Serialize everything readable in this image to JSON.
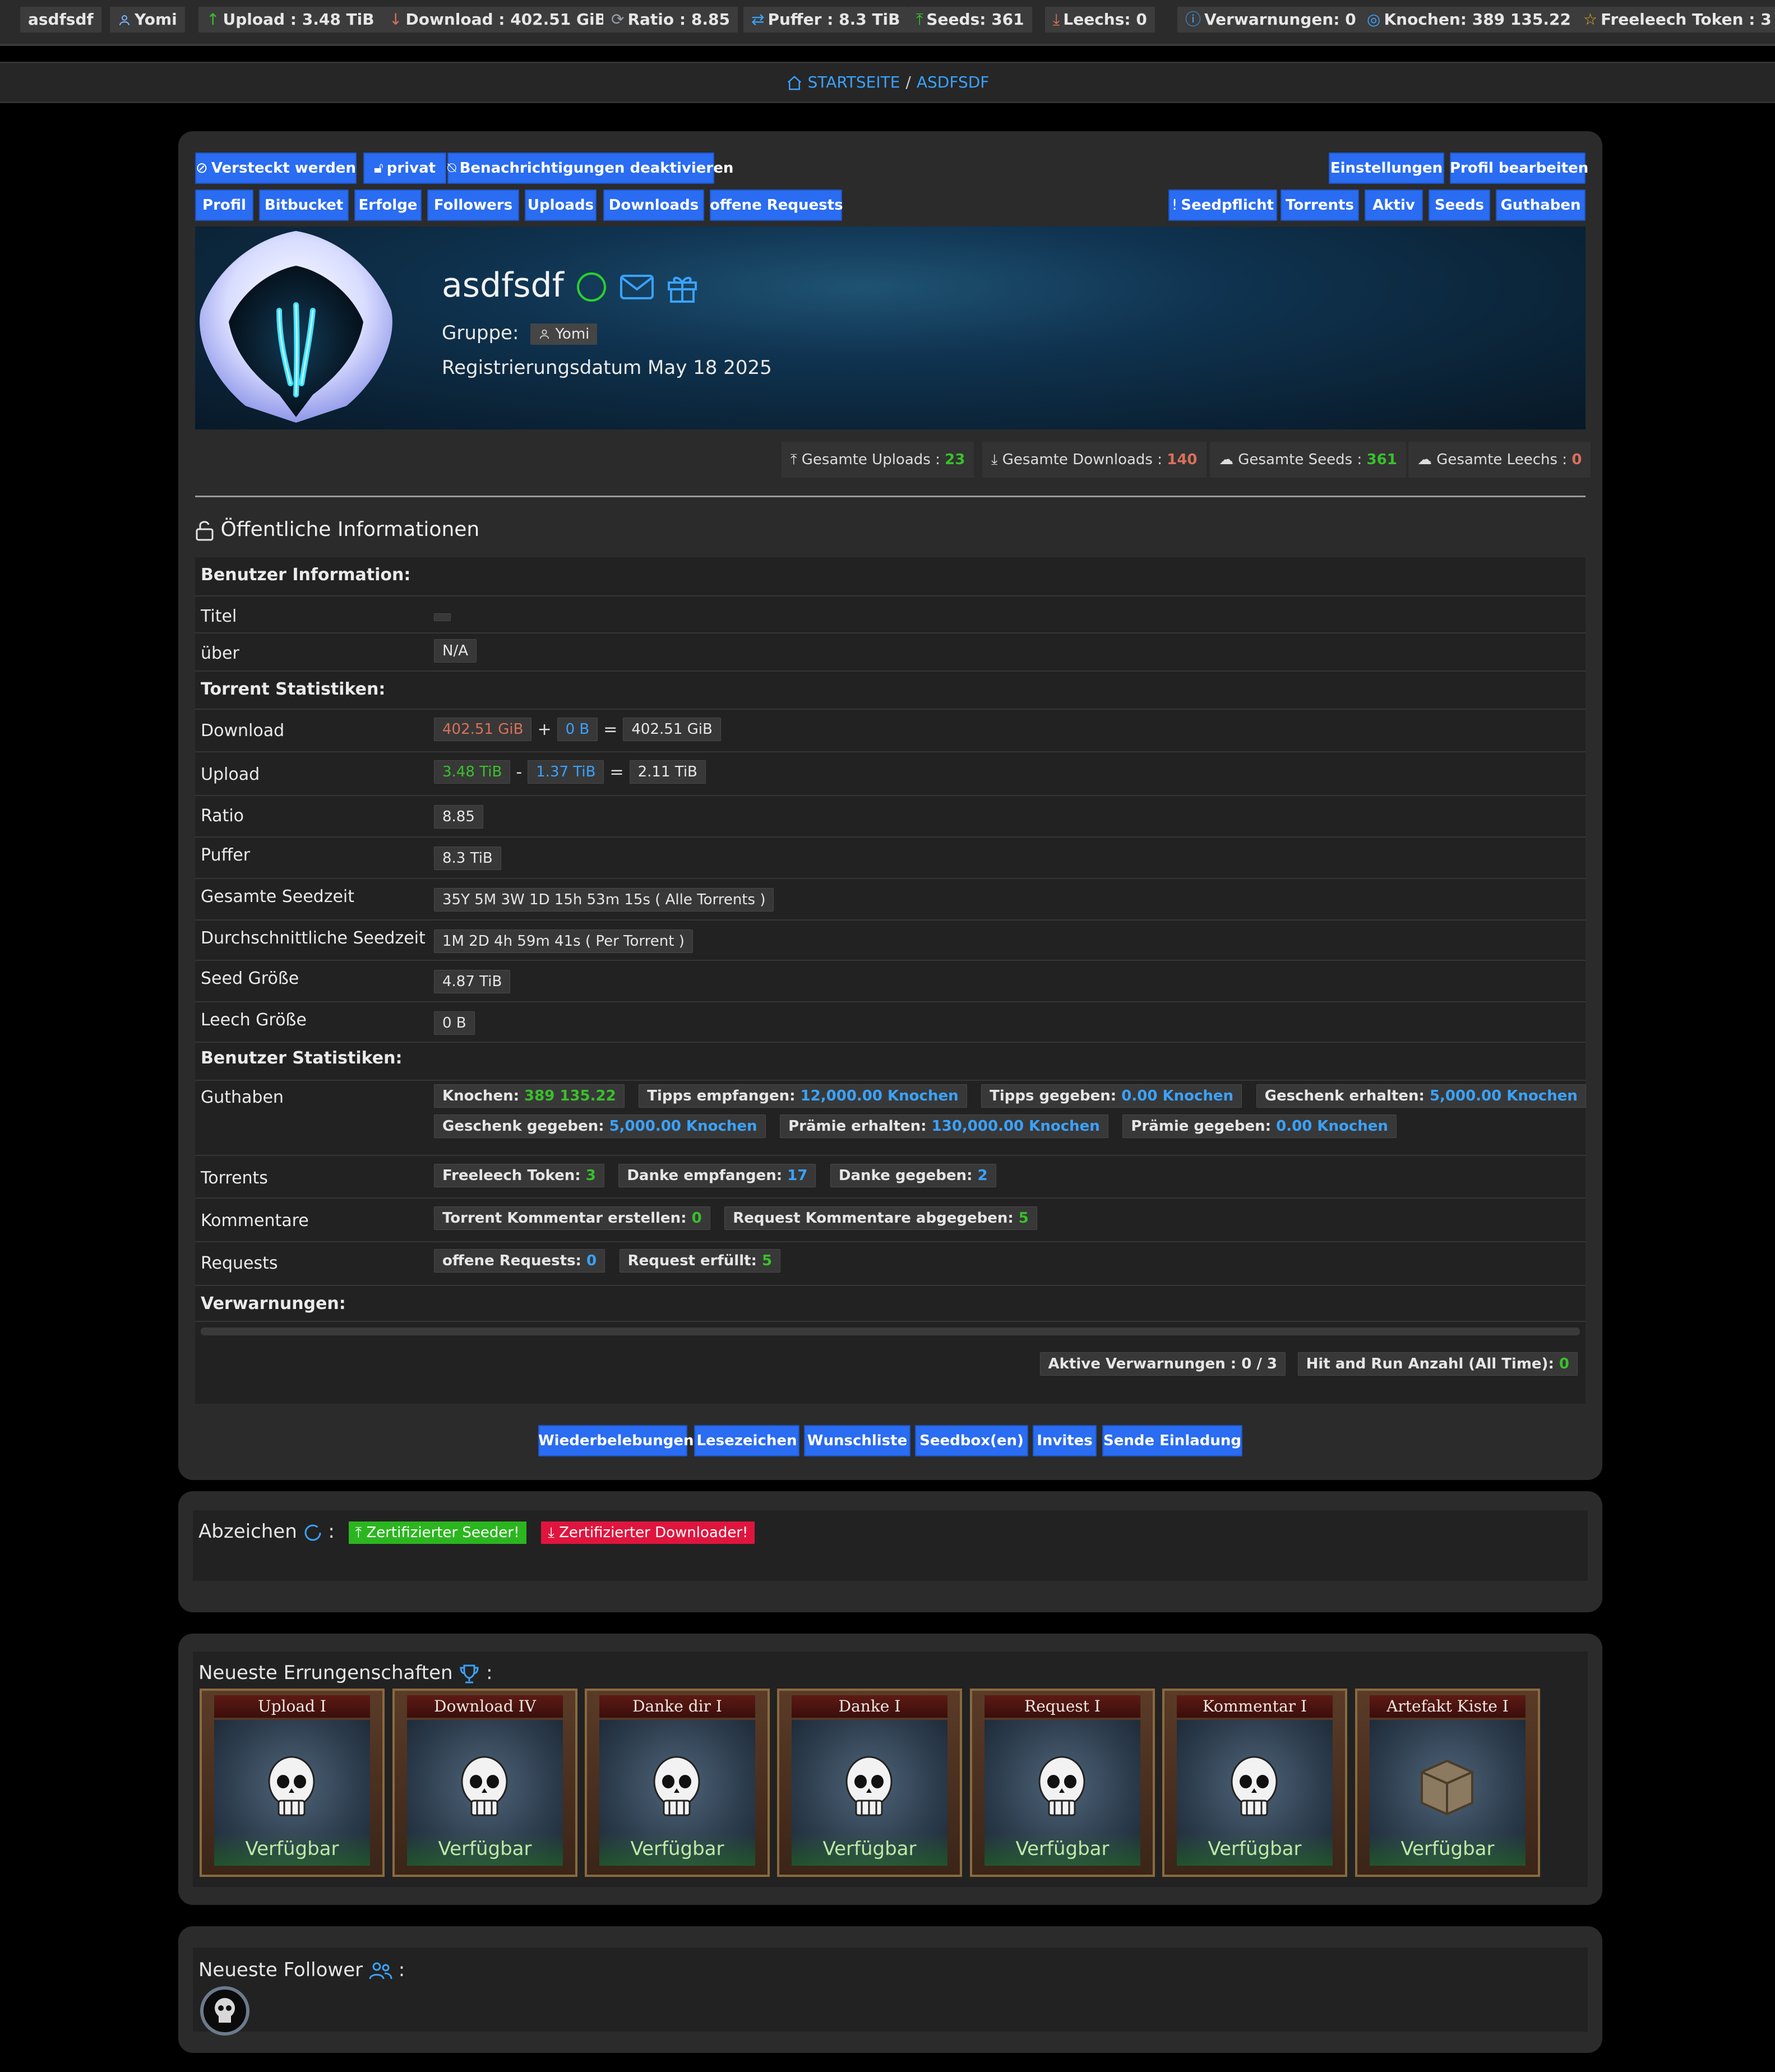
{
  "topbar": {
    "username": "asdfsdf",
    "group": "Yomi",
    "upload": "Upload : 3.48 TiB",
    "download": "Download : 402.51 GiB",
    "ratio": "Ratio : 8.85",
    "puffer": "Puffer : 8.3 TiB",
    "seeds": "Seeds: 361",
    "leechs": "Leechs: 0",
    "warnings": "Verwarnungen: 0",
    "knochen": "Knochen: 389 135.22",
    "freeleech": "Freeleech Token : 3"
  },
  "breadcrumb": {
    "home": "STARTSEITE",
    "separator": "/",
    "current": "ASDFSDF"
  },
  "profile": {
    "action_buttons": [
      "Versteckt werden",
      "privat",
      "Benachrichtigungen deaktivieren"
    ],
    "settings_buttons": [
      "Einstellungen",
      "Profil bearbeiten"
    ],
    "nav_tabs": [
      "Profil",
      "Bitbucket",
      "Erfolge",
      "Followers",
      "Uploads",
      "Downloads",
      "offene Requests"
    ],
    "nav_tabs_right": [
      "Seedpflicht",
      "Torrents",
      "Aktiv",
      "Seeds",
      "Guthaben"
    ],
    "name": "asdfsdf",
    "group_label": "Gruppe:",
    "group_value": "Yomi",
    "registration": "Registrierungsdatum May 18 2025",
    "totals": {
      "uploads_label": "Gesamte Uploads :",
      "uploads_value": "23",
      "downloads_label": "Gesamte Downloads :",
      "downloads_value": "140",
      "seeds_label": "Gesamte Seeds :",
      "seeds_value": "361",
      "leechs_label": "Gesamte Leechs :",
      "leechs_value": "0"
    }
  },
  "info": {
    "title": "Öffentliche Informationen",
    "user_info_header": "Benutzer Information:",
    "titel_label": "Titel",
    "ueber_label": "über",
    "ueber_value": "N/A",
    "torrent_stats_header": "Torrent Statistiken:",
    "download_label": "Download",
    "download_a": "402.51 GiB",
    "download_op1": "+",
    "download_b": "0 B",
    "download_op2": "=",
    "download_c": "402.51 GiB",
    "upload_label": "Upload",
    "upload_a": "3.48 TiB",
    "upload_op1": "-",
    "upload_b": "1.37 TiB",
    "upload_op2": "=",
    "upload_c": "2.11 TiB",
    "ratio_label": "Ratio",
    "ratio_value": "8.85",
    "puffer_label": "Puffer",
    "puffer_value": "8.3 TiB",
    "seedtime_label": "Gesamte Seedzeit",
    "seedtime_value": "35Y 5M 3W 1D 15h 53m 15s ( Alle Torrents )",
    "avg_seedtime_label": "Durchschnittliche Seedzeit",
    "avg_seedtime_value": "1M 2D 4h 59m 41s ( Per Torrent )",
    "seedsize_label": "Seed Größe",
    "seedsize_value": "4.87 TiB",
    "leechsize_label": "Leech Größe",
    "leechsize_value": "0 B",
    "user_stats_header": "Benutzer Statistiken:",
    "guthaben_label": "Guthaben",
    "knochen_label": "Knochen:",
    "knochen_value": "389 135.22",
    "tips_recv_label": "Tipps empfangen:",
    "tips_recv_value": "12,000.00 Knochen",
    "tips_given_label": "Tipps gegeben:",
    "tips_given_value": "0.00 Knochen",
    "gift_recv_label": "Geschenk erhalten:",
    "gift_recv_value": "5,000.00 Knochen",
    "gift_given_label": "Geschenk gegeben:",
    "gift_given_value": "5,000.00 Knochen",
    "bounty_recv_label": "Prämie erhalten:",
    "bounty_recv_value": "130,000.00 Knochen",
    "bounty_given_label": "Prämie gegeben:",
    "bounty_given_value": "0.00 Knochen",
    "torrents_label": "Torrents",
    "freeleech_label": "Freeleech Token:",
    "freeleech_value": "3",
    "thanks_recv_label": "Danke empfangen:",
    "thanks_recv_value": "17",
    "thanks_given_label": "Danke gegeben:",
    "thanks_given_value": "2",
    "comments_label": "Kommentare",
    "torrent_comment_label": "Torrent Kommentar erstellen:",
    "torrent_comment_value": "0",
    "request_comment_label": "Request Kommentare abgegeben:",
    "request_comment_value": "5",
    "requests_label": "Requests",
    "open_requests_label": "offene Requests:",
    "open_requests_value": "0",
    "filled_requests_label": "Request erfüllt:",
    "filled_requests_value": "5",
    "warnings_header": "Verwarnungen:",
    "active_warnings": "Aktive Verwarnungen : 0 / 3",
    "hnr_label": "Hit and Run Anzahl (All Time):",
    "hnr_value": "0"
  },
  "bottom_buttons": [
    "Wiederbelebungen",
    "Lesezeichen",
    "Wunschliste",
    "Seedbox(en)",
    "Invites",
    "Sende Einladung"
  ],
  "badges": {
    "title": "Abzeichen",
    "colon": ":",
    "seeder": "Zertifizierter Seeder!",
    "downloader": "Zertifizierter Downloader!"
  },
  "achievements": {
    "title": "Neueste Errungenschaften",
    "colon": ":",
    "items": [
      {
        "name": "Upload I",
        "status": "Verfügbar",
        "icon": "skull-crown-icon"
      },
      {
        "name": "Download IV",
        "status": "Verfügbar",
        "icon": "skull-cap-icon"
      },
      {
        "name": "Danke dir I",
        "status": "Verfügbar",
        "icon": "skull-beard-icon"
      },
      {
        "name": "Danke I",
        "status": "Verfügbar",
        "icon": "skull-icon"
      },
      {
        "name": "Request I",
        "status": "Verfügbar",
        "icon": "skull-sunglasses-icon"
      },
      {
        "name": "Kommentar I",
        "status": "Verfügbar",
        "icon": "skull-tophat-icon"
      },
      {
        "name": "Artefakt Kiste I",
        "status": "Verfügbar",
        "icon": "crate-icon"
      }
    ]
  },
  "followers": {
    "title": "Neueste Follower",
    "colon": ":"
  },
  "colors": {
    "accent": "#2a6cf2",
    "link": "#3aa2ff",
    "green": "#39c02b",
    "red": "#d9705a",
    "badge_green": "#2bb61f",
    "badge_red": "#e0153e",
    "panel": "#2b2b2b"
  }
}
